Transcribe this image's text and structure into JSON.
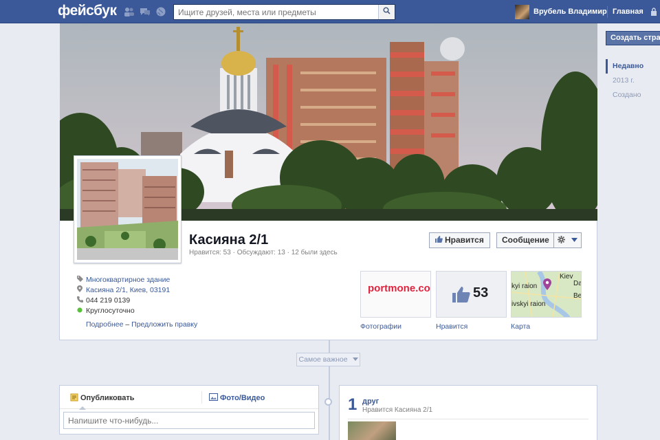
{
  "topbar": {
    "logo": "фейсбук",
    "search_placeholder": "Ищите друзей, места или предметы",
    "user_name": "Врубель Владимир",
    "home_label": "Главная"
  },
  "right": {
    "create_page": "Создать стра",
    "timeline": [
      "Недавно",
      "2013 г.",
      "Создано"
    ]
  },
  "page": {
    "title": "Касияна 2/1",
    "stats": "Нравится: 53 · Обсуждают: 13 · 12 были здесь",
    "like_button": "Нравится",
    "message_button": "Сообщение",
    "info": [
      {
        "icon": "tag-icon",
        "text": "Многоквартирное здание",
        "link": true
      },
      {
        "icon": "pin-icon",
        "text": "Касияна 2/1, Киев, 03191",
        "link": true
      },
      {
        "icon": "phone-icon",
        "text": "044 219 0139",
        "link": false
      },
      {
        "icon": "open-dot-icon",
        "text": "Круглосуточно",
        "link": false
      }
    ],
    "more_link": "Подробнее",
    "suggest_link": "Предложить правку",
    "apps": {
      "photos": {
        "label": "Фотографии",
        "brand": "portmone.co"
      },
      "likes": {
        "label": "Нравится",
        "count": "53"
      },
      "map": {
        "label": "Карта",
        "labels": [
          "Kiev",
          "kyi raion",
          "ivskyi raion",
          "Da",
          "Be"
        ]
      }
    }
  },
  "timeline": {
    "filter": "Самое важное",
    "post_tab": "Опубликовать",
    "photo_tab": "Фото/Видео",
    "post_placeholder": "Напишите что-нибудь...",
    "friends_count": "1",
    "friends_word": "друг",
    "friends_sub": "Нравится Касияна 2/1"
  },
  "colors": {
    "brand": "#3b5998",
    "background": "#e9ebf2"
  }
}
